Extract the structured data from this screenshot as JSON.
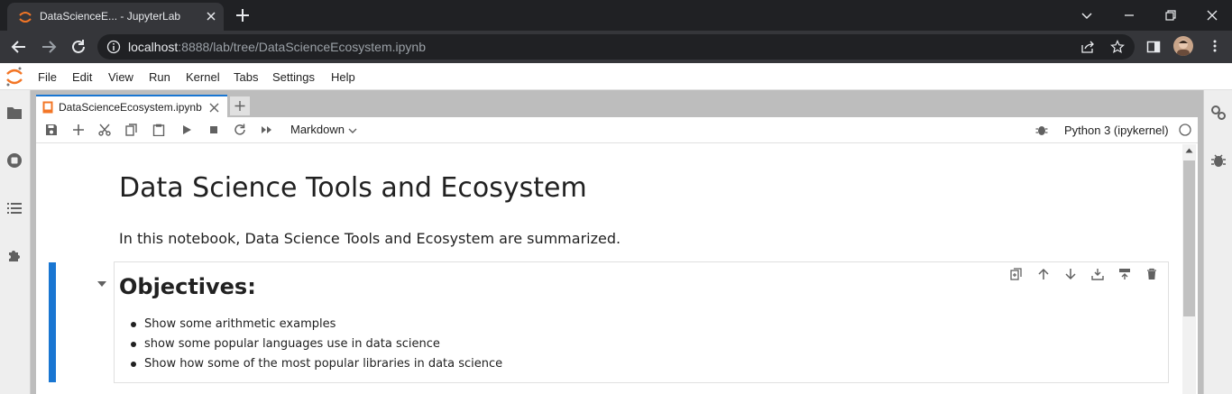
{
  "browser": {
    "tab_title": "DataScienceE... - JupyterLab",
    "url_host": "localhost",
    "url_rest": ":8888/lab/tree/DataScienceEcosystem.ipynb"
  },
  "jupyter": {
    "menu": [
      "File",
      "Edit",
      "View",
      "Run",
      "Kernel",
      "Tabs",
      "Settings",
      "Help"
    ],
    "document_tab": "DataScienceEcosystem.ipynb",
    "cell_type": "Markdown",
    "kernel": "Python 3 (ipykernel)"
  },
  "notebook": {
    "title": "Data Science Tools and Ecosystem",
    "intro": "In this notebook, Data Science Tools and Ecosystem are summarized.",
    "objectives_heading": "Objectives:",
    "objectives": [
      "Show some arithmetic examples",
      "show some popular languages use in data science",
      "Show how some of the most popular libraries in data science"
    ]
  },
  "colors": {
    "accent": "#1976d2",
    "jupyter_orange": "#f37626",
    "browser_dark": "#202124"
  },
  "icons": [
    "chrome-tab-favicon",
    "tab-close-icon",
    "new-tab-icon",
    "minimize-icon",
    "maximize-icon",
    "close-window-icon",
    "back-icon",
    "forward-icon",
    "reload-icon",
    "info-icon",
    "share-icon",
    "star-icon",
    "side-panel-icon",
    "folder-icon",
    "stop-circle-icon",
    "toc-icon",
    "extension-icon",
    "gears-icon",
    "debugger-icon",
    "save-icon",
    "add-cell-icon",
    "cut-icon",
    "copy-icon",
    "paste-icon",
    "run-icon",
    "stop-icon",
    "restart-icon",
    "fast-forward-icon",
    "duplicate-icon",
    "move-up-icon",
    "move-down-icon",
    "insert-below-icon",
    "insert-above-icon",
    "delete-icon"
  ]
}
